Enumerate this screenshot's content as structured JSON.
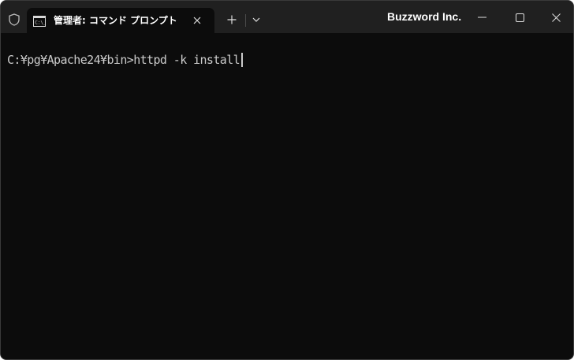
{
  "window": {
    "brand": "Buzzword Inc.",
    "colors": {
      "titlebar": "#202020",
      "terminal_bg": "#0c0c0c",
      "text": "#cccccc"
    }
  },
  "tab": {
    "title": "管理者: コマンド プロンプト",
    "icon": "terminal-icon"
  },
  "icons": {
    "shield": "shield-icon",
    "close_tab": "close-icon",
    "new_tab": "plus-icon",
    "dropdown": "chevron-down-icon",
    "minimize": "minimize-icon",
    "maximize": "maximize-icon",
    "close_window": "close-icon"
  },
  "terminal": {
    "prompt": "C:¥pg¥Apache24¥bin>",
    "command": "httpd -k install"
  }
}
